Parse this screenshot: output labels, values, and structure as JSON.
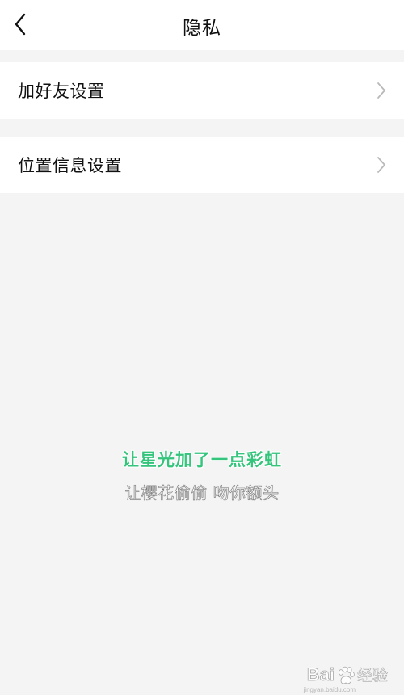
{
  "header": {
    "title": "隐私",
    "back_icon": "chevron-left-icon"
  },
  "menu": {
    "items": [
      {
        "label": "加好友设置",
        "icon": "chevron-right-icon"
      },
      {
        "label": "位置信息设置",
        "icon": "chevron-right-icon"
      }
    ]
  },
  "subtitles": {
    "line1": "让星光加了一点彩虹",
    "line2": "让樱花偷偷 吻你额头"
  },
  "watermark": {
    "brand": "Bai",
    "suffix": "经验",
    "url": "jingyan.baidu.com"
  },
  "colors": {
    "background": "#f4f4f4",
    "surface": "#ffffff",
    "lyric_green": "#34c47c",
    "chevron": "#b9b9b9"
  }
}
